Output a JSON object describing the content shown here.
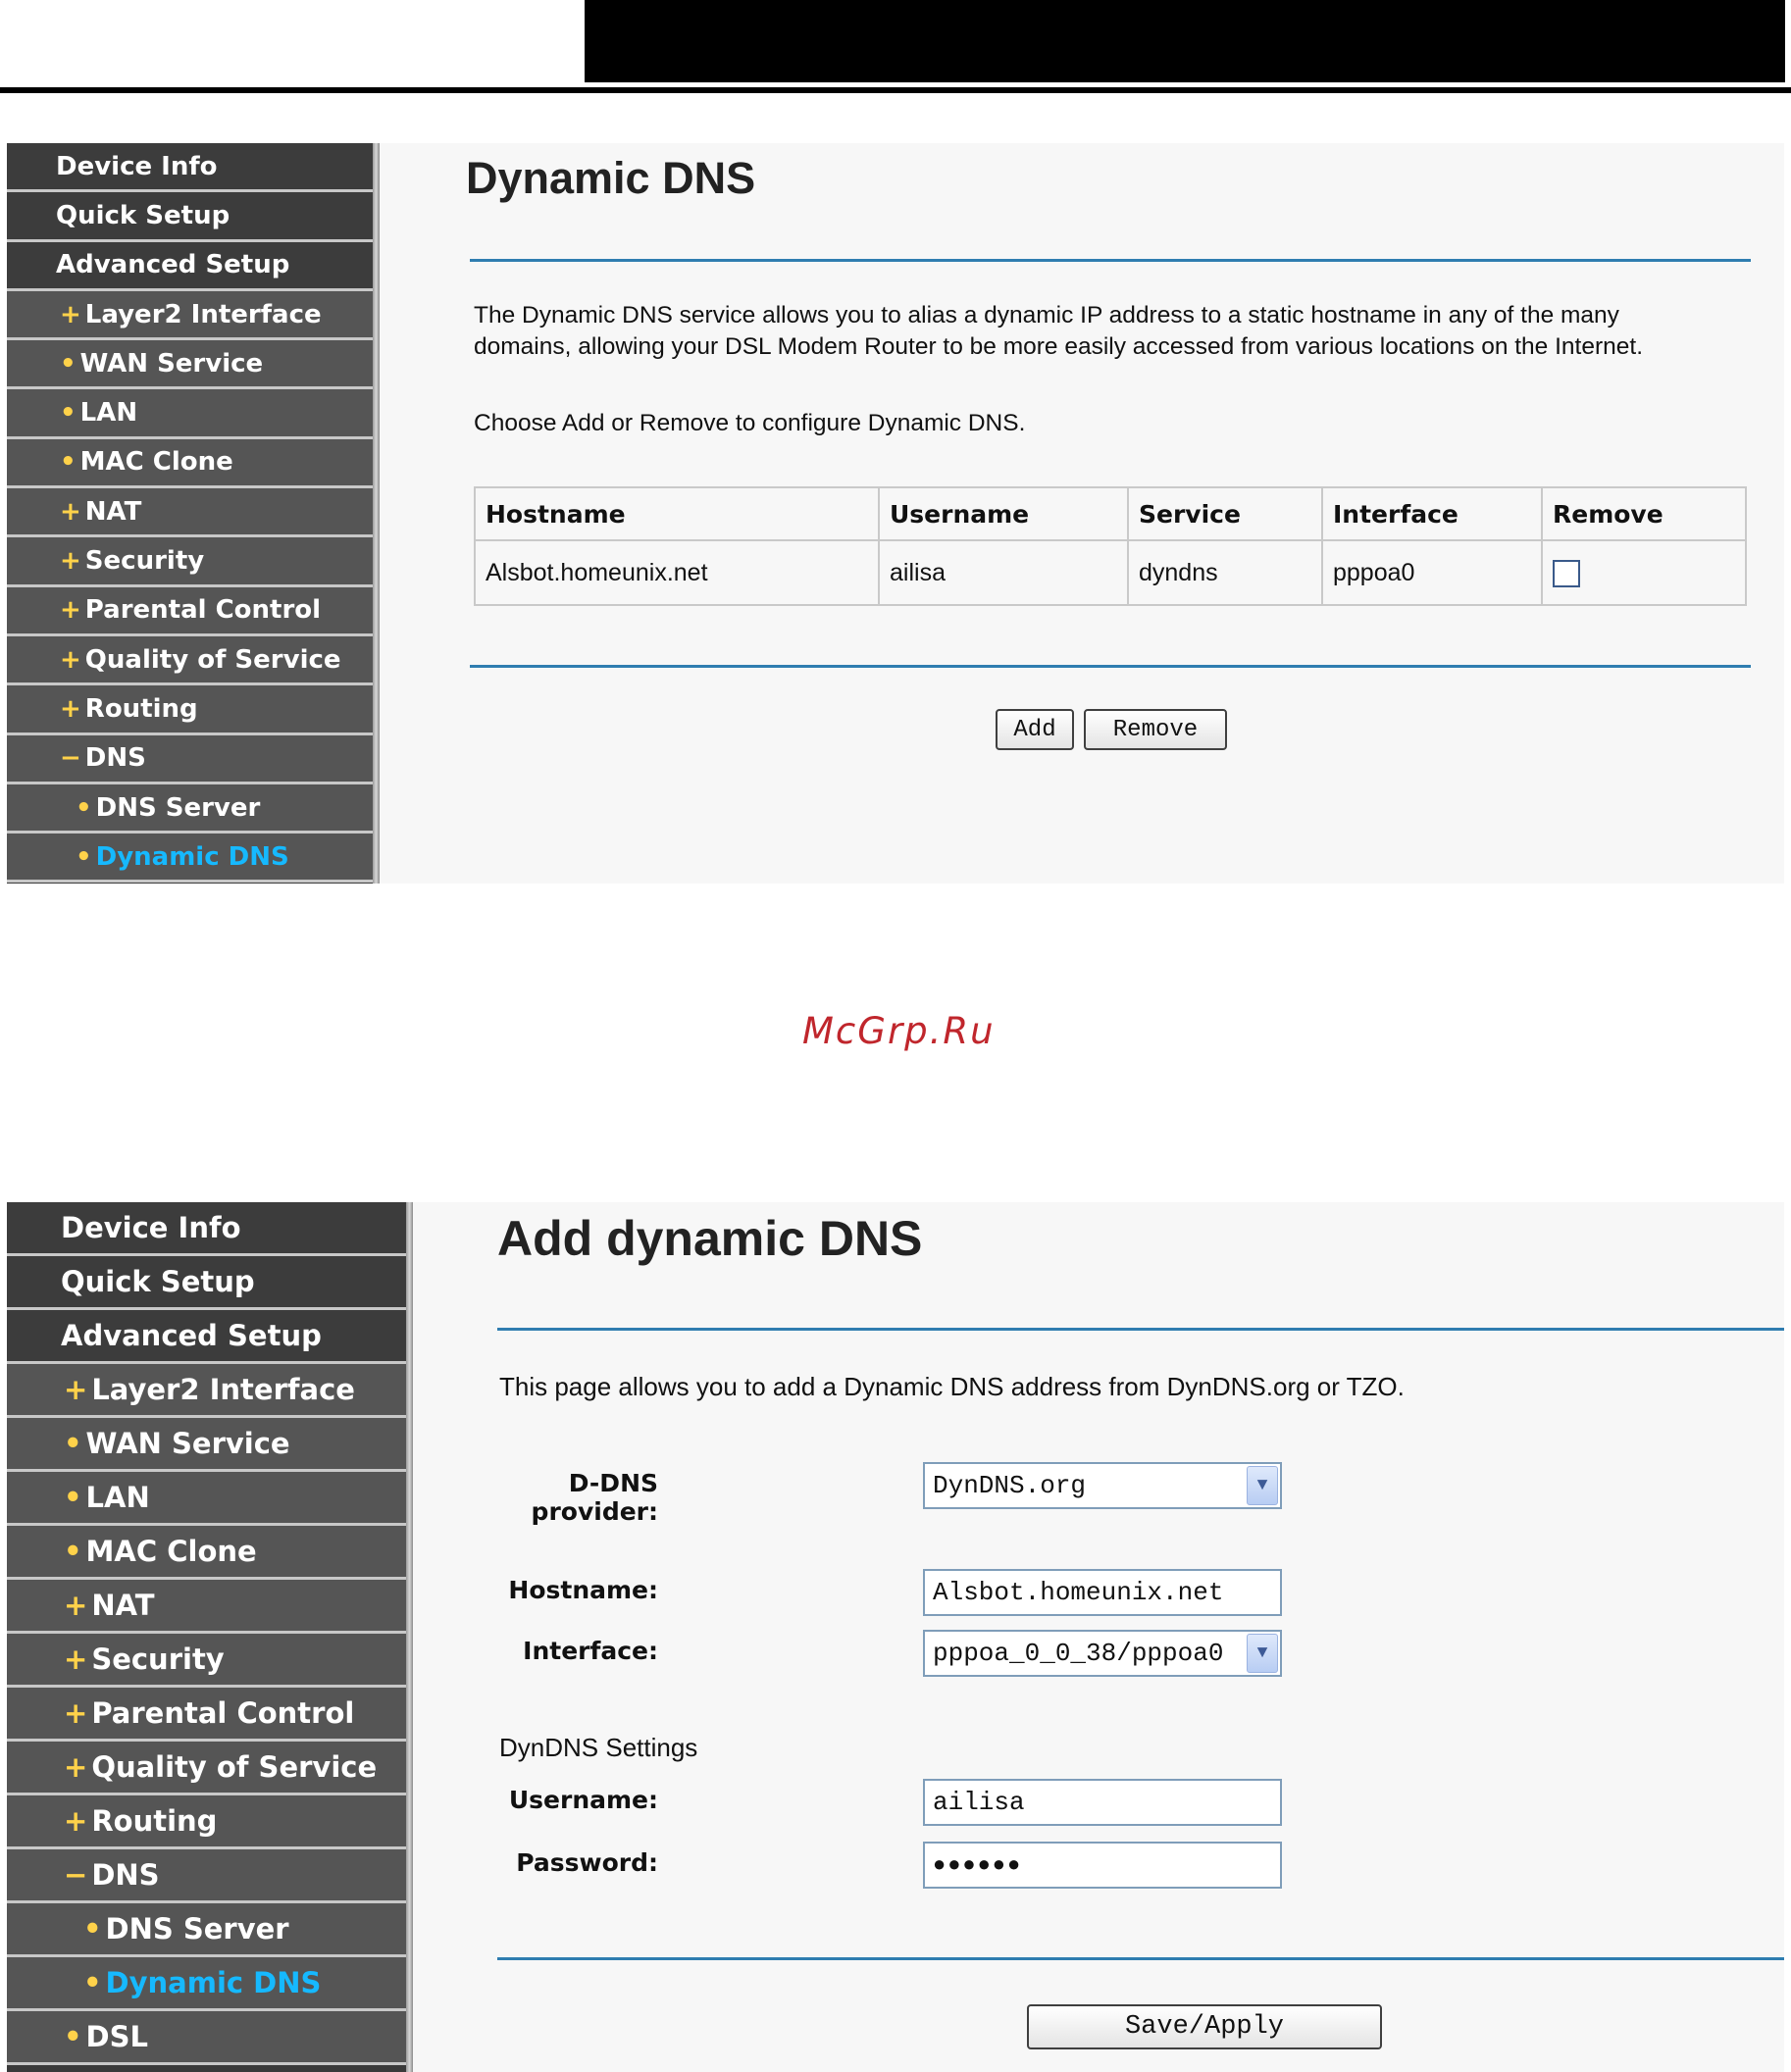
{
  "watermark": "McGrp.Ru",
  "panel1": {
    "sidebar": [
      {
        "prefix": "",
        "label": "Device Info"
      },
      {
        "prefix": "",
        "label": "Quick Setup"
      },
      {
        "prefix": "",
        "label": "Advanced Setup"
      },
      {
        "prefix": "+",
        "label": "Layer2 Interface"
      },
      {
        "prefix": "•",
        "label": "WAN Service"
      },
      {
        "prefix": "•",
        "label": "LAN"
      },
      {
        "prefix": "•",
        "label": "MAC Clone"
      },
      {
        "prefix": "+",
        "label": "NAT"
      },
      {
        "prefix": "+",
        "label": "Security"
      },
      {
        "prefix": "+",
        "label": "Parental Control"
      },
      {
        "prefix": "+",
        "label": "Quality of Service"
      },
      {
        "prefix": "+",
        "label": "Routing"
      },
      {
        "prefix": "−",
        "label": "DNS"
      },
      {
        "prefix": "•",
        "label": "DNS Server"
      },
      {
        "prefix": "•",
        "label": "Dynamic DNS"
      }
    ],
    "title": "Dynamic DNS",
    "description_line1": "The Dynamic DNS service allows you to alias a dynamic IP address to a static hostname in any of the many",
    "description_line2": "domains, allowing your DSL Modem Router to be more easily accessed from various locations on the Internet.",
    "instruction": "Choose Add or Remove to configure Dynamic DNS.",
    "table": {
      "headers": [
        "Hostname",
        "Username",
        "Service",
        "Interface",
        "Remove"
      ],
      "rows": [
        {
          "hostname": "Alsbot.homeunix.net",
          "username": "ailisa",
          "service": "dyndns",
          "interface": "pppoa0"
        }
      ]
    },
    "add_label": "Add",
    "remove_label": "Remove"
  },
  "panel2": {
    "sidebar": [
      {
        "prefix": "",
        "label": "Device Info"
      },
      {
        "prefix": "",
        "label": "Quick Setup"
      },
      {
        "prefix": "",
        "label": "Advanced Setup"
      },
      {
        "prefix": "+",
        "label": "Layer2 Interface"
      },
      {
        "prefix": "•",
        "label": "WAN Service"
      },
      {
        "prefix": "•",
        "label": "LAN"
      },
      {
        "prefix": "•",
        "label": "MAC Clone"
      },
      {
        "prefix": "+",
        "label": "NAT"
      },
      {
        "prefix": "+",
        "label": "Security"
      },
      {
        "prefix": "+",
        "label": "Parental Control"
      },
      {
        "prefix": "+",
        "label": "Quality of Service"
      },
      {
        "prefix": "+",
        "label": "Routing"
      },
      {
        "prefix": "−",
        "label": "DNS"
      },
      {
        "prefix": "•",
        "label": "DNS Server"
      },
      {
        "prefix": "•",
        "label": "Dynamic DNS"
      },
      {
        "prefix": "•",
        "label": "DSL"
      }
    ],
    "title": "Add dynamic DNS",
    "description": "This page allows you to add a Dynamic DNS address from DynDNS.org or TZO.",
    "provider_label": "D-DNS provider:",
    "provider_value": "DynDNS.org",
    "hostname_label": "Hostname:",
    "hostname_value": "Alsbot.homeunix.net",
    "interface_label": "Interface:",
    "interface_value": "pppoa_0_0_38/pppoa0",
    "settings_heading": "DynDNS Settings",
    "username_label": "Username:",
    "username_value": "ailisa",
    "password_label": "Password:",
    "password_value": "●●●●●●",
    "save_label": "Save/Apply"
  },
  "colors": {
    "accent_rule": "#2f7db0",
    "active_nav": "#16b9ff",
    "nav_bg": "#555555",
    "nav_prefix": "#ffd24a"
  }
}
